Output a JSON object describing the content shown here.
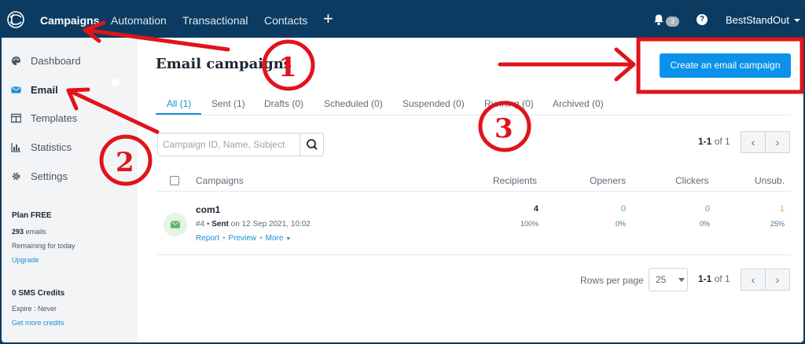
{
  "topbar": {
    "nav": [
      "Campaigns",
      "Automation",
      "Transactional",
      "Contacts"
    ],
    "plus_label": "+",
    "notifications_count": "3",
    "help_label": "?",
    "account_name": "BestStandOut"
  },
  "sidebar": {
    "items": [
      {
        "label": "Dashboard",
        "icon": "palette-icon"
      },
      {
        "label": "Email",
        "icon": "envelope-icon"
      },
      {
        "label": "Templates",
        "icon": "template-icon"
      },
      {
        "label": "Statistics",
        "icon": "bar-chart-icon"
      },
      {
        "label": "Settings",
        "icon": "gear-icon"
      }
    ],
    "plan": {
      "title": "Plan FREE",
      "emails_count": "293",
      "emails_label": "emails",
      "remaining": "Remaining for today",
      "upgrade": "Upgrade"
    },
    "sms": {
      "title": "0 SMS Credits",
      "expire": "Expire : Never",
      "more": "Get more credits"
    }
  },
  "main": {
    "title": "Email campaigns",
    "create_button": "Create an email campaign",
    "tabs": [
      "All (1)",
      "Sent (1)",
      "Drafts (0)",
      "Scheduled (0)",
      "Suspended (0)",
      "Running (0)",
      "Archived (0)"
    ],
    "search_placeholder": "Campaign ID, Name, Subject",
    "pager": {
      "range": "1-1",
      "of": "of 1"
    },
    "columns": [
      "Campaigns",
      "Recipients",
      "Openers",
      "Clickers",
      "Unsub."
    ],
    "rows": [
      {
        "name": "com1",
        "id": "#4",
        "status": "Sent",
        "date_text": "on 12 Sep 2021, 10:02",
        "actions": [
          "Report",
          "Preview",
          "More"
        ],
        "recipients": "4",
        "recipients_pct": "100%",
        "openers": "0",
        "openers_pct": "0%",
        "clickers": "0",
        "clickers_pct": "0%",
        "unsub": "1",
        "unsub_pct": "25%"
      }
    ],
    "rows_per_page_label": "Rows per page",
    "rows_per_page": "25"
  },
  "annotations": {
    "labels": [
      "1",
      "2",
      "3"
    ],
    "color": "#e0141a"
  },
  "colors": {
    "topbar": "#0b3b60",
    "accent": "#0a92ea",
    "openers": "#1fb5d6",
    "clickers": "#5cb85c",
    "unsub": "#f0a45d"
  }
}
